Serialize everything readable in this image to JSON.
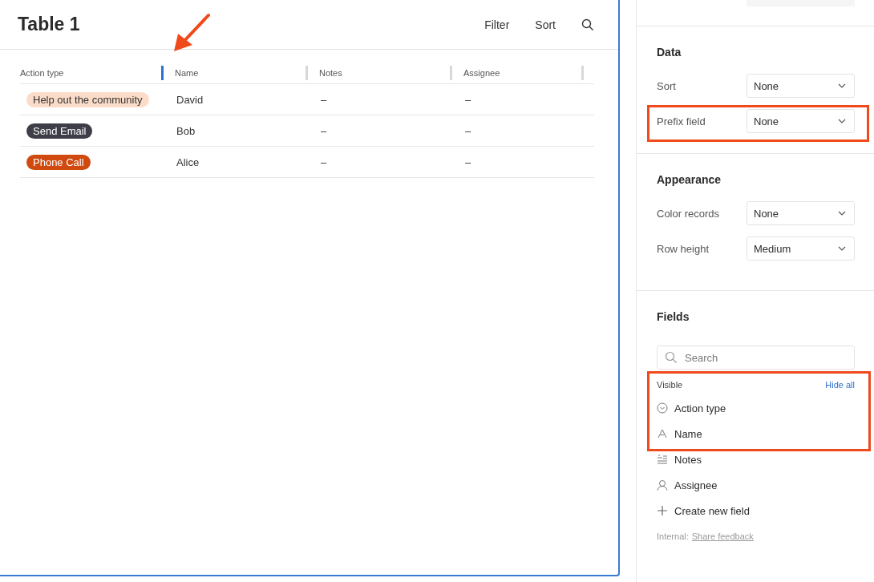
{
  "table": {
    "title": "Table 1",
    "toolbar": [
      "Filter",
      "Sort"
    ],
    "annotation_arrow": true,
    "columns": [
      {
        "label": "Action type",
        "resize_active": true
      },
      {
        "label": "Name",
        "resize_active": false
      },
      {
        "label": "Notes",
        "resize_active": false
      },
      {
        "label": "Assignee",
        "resize_active": false
      }
    ],
    "rows": [
      {
        "cells": [
          {
            "kind": "tag",
            "text": "Help out the community",
            "color": "#fbdcc8"
          },
          {
            "kind": "text",
            "text": "David"
          },
          {
            "kind": "text",
            "text": "–"
          },
          {
            "kind": "text",
            "text": "–"
          }
        ]
      },
      {
        "cells": [
          {
            "kind": "tag",
            "text": "Send Email",
            "color": "#3d3e48"
          },
          {
            "kind": "text",
            "text": "Bob"
          },
          {
            "kind": "text",
            "text": "–"
          },
          {
            "kind": "text",
            "text": "–"
          }
        ]
      },
      {
        "cells": [
          {
            "kind": "tag",
            "text": "Phone Call",
            "color": "#d04a10"
          },
          {
            "kind": "text",
            "text": "Alice"
          },
          {
            "kind": "text",
            "text": "–"
          },
          {
            "kind": "text",
            "text": "–"
          }
        ]
      }
    ]
  },
  "panel": {
    "sections": [
      {
        "title": "Data",
        "settings": [
          {
            "label": "Sort",
            "value": "None",
            "highlighted": false
          },
          {
            "label": "Prefix field",
            "value": "None",
            "highlighted": true
          }
        ]
      },
      {
        "title": "Appearance",
        "settings": [
          {
            "label": "Color records",
            "value": "None",
            "highlighted": false
          },
          {
            "label": "Row height",
            "value": "Medium",
            "highlighted": false
          }
        ]
      }
    ],
    "fields": {
      "title": "Fields",
      "search_placeholder": "Search",
      "visible_label": "Visible",
      "hide_all": "Hide all",
      "visible_highlighted": true,
      "visible": [
        {
          "kind": "select",
          "label": "Action type"
        },
        {
          "kind": "text",
          "label": "Name"
        }
      ],
      "hidden": [
        {
          "kind": "notes",
          "label": "Notes"
        },
        {
          "kind": "person",
          "label": "Assignee"
        }
      ],
      "create": "Create new field"
    },
    "footer": {
      "prefix": "Internal:",
      "link": "Share feedback"
    }
  }
}
